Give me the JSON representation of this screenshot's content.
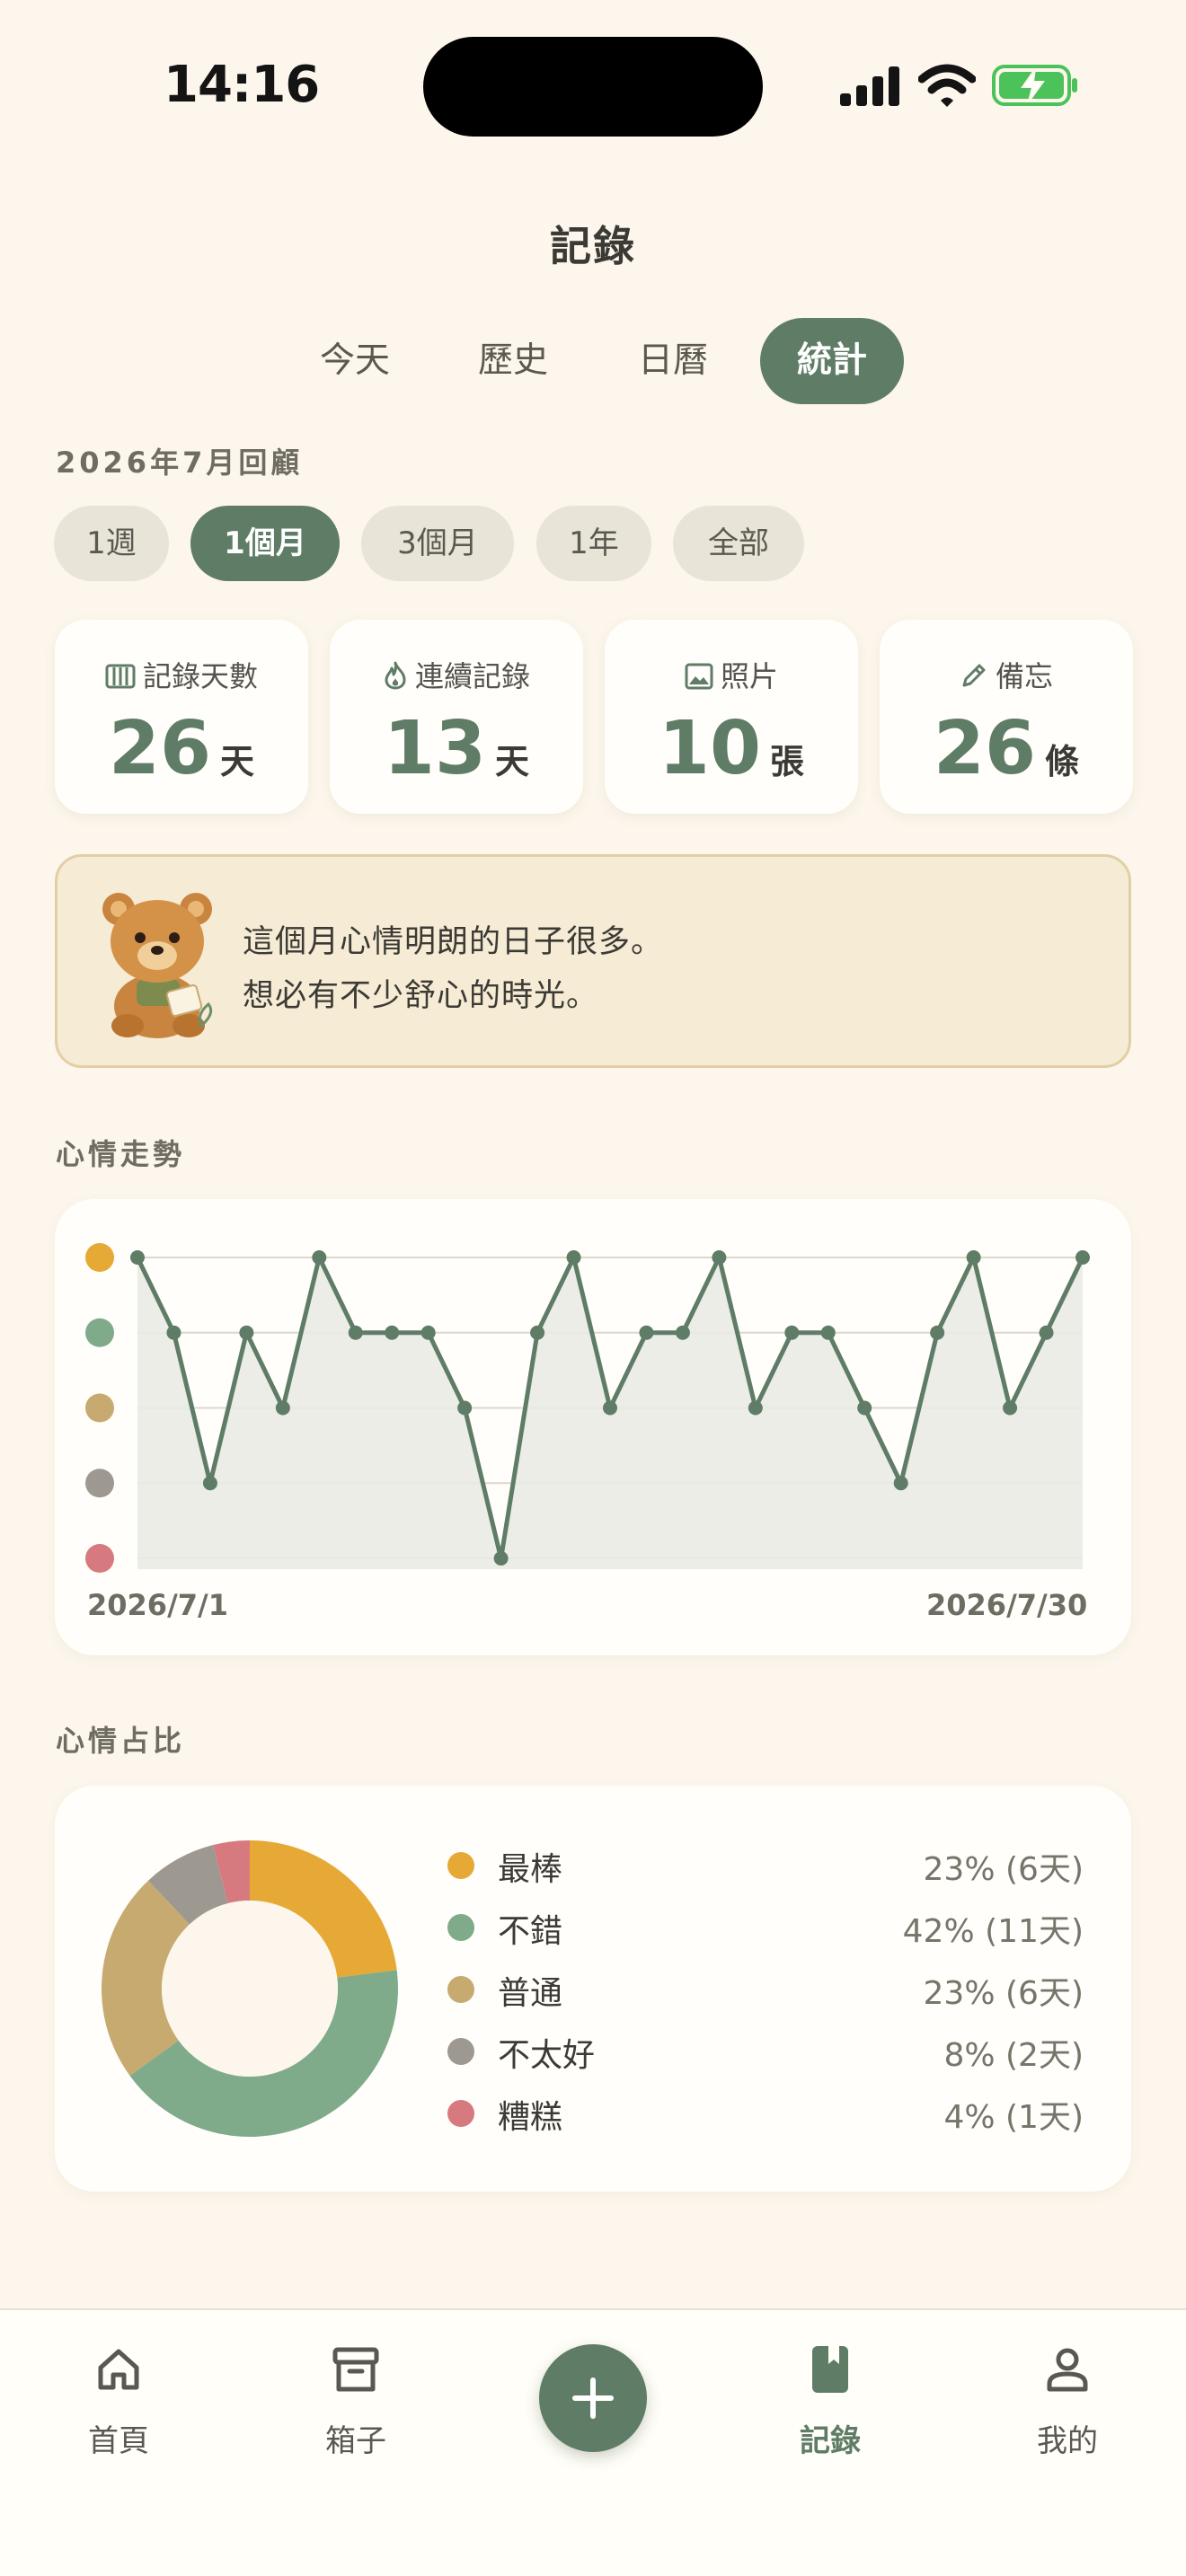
{
  "status": {
    "time": "14:16"
  },
  "title": "記錄",
  "tabs": [
    {
      "label": "今天",
      "active": false
    },
    {
      "label": "歷史",
      "active": false
    },
    {
      "label": "日曆",
      "active": false
    },
    {
      "label": "統計",
      "active": true
    }
  ],
  "review_title": "2026年7月回顧",
  "ranges": [
    {
      "label": "1週",
      "active": false
    },
    {
      "label": "1個月",
      "active": true
    },
    {
      "label": "3個月",
      "active": false
    },
    {
      "label": "1年",
      "active": false
    },
    {
      "label": "全部",
      "active": false
    }
  ],
  "stats": [
    {
      "icon": "barcode-icon",
      "label": "記錄天數",
      "value": "26",
      "unit": "天"
    },
    {
      "icon": "flame-icon",
      "label": "連續記錄",
      "value": "13",
      "unit": "天"
    },
    {
      "icon": "image-icon",
      "label": "照片",
      "value": "10",
      "unit": "張"
    },
    {
      "icon": "pencil-icon",
      "label": "備忘",
      "value": "26",
      "unit": "條"
    }
  ],
  "message": {
    "line1": "這個月心情明朗的日子很多。",
    "line2": "想必有不少舒心的時光。"
  },
  "trend": {
    "title": "心情走勢",
    "start_label": "2026/7/1",
    "end_label": "2026/7/30"
  },
  "ratio": {
    "title": "心情占比",
    "items": [
      {
        "name": "最棒",
        "value": "23% (6天)",
        "color": "#E6A935"
      },
      {
        "name": "不錯",
        "value": "42% (11天)",
        "color": "#80AB8B"
      },
      {
        "name": "普通",
        "value": "23% (6天)",
        "color": "#C7AA6F"
      },
      {
        "name": "不太好",
        "value": "8% (2天)",
        "color": "#9D9990"
      },
      {
        "name": "糟糕",
        "value": "4% (1天)",
        "color": "#D77A7F"
      }
    ]
  },
  "chart_data": [
    {
      "type": "area",
      "title": "心情走勢",
      "y_levels": [
        "糟糕",
        "不太好",
        "普通",
        "不錯",
        "最棒"
      ],
      "level_colors": [
        "#D77A7F",
        "#9D9990",
        "#C7AA6F",
        "#80AB8B",
        "#E6A935"
      ],
      "x_start": "2026/7/1",
      "x_end": "2026/7/30",
      "values": [
        5,
        4,
        2,
        4,
        3,
        5,
        4,
        4,
        4,
        3,
        1,
        4,
        5,
        3,
        4,
        4,
        5,
        3,
        4,
        4,
        3,
        2,
        4,
        5,
        3,
        4,
        5
      ],
      "ylim": [
        1,
        5
      ],
      "grid": true
    },
    {
      "type": "pie",
      "title": "心情占比",
      "labels": [
        "最棒",
        "不錯",
        "普通",
        "不太好",
        "糟糕"
      ],
      "values": [
        23,
        42,
        23,
        8,
        4
      ],
      "days": [
        6,
        11,
        6,
        2,
        1
      ],
      "colors": [
        "#E6A935",
        "#80AB8B",
        "#C7AA6F",
        "#9D9990",
        "#D77A7F"
      ]
    }
  ],
  "nav": [
    {
      "label": "首頁",
      "icon": "home-icon",
      "active": false
    },
    {
      "label": "箱子",
      "icon": "archive-box-icon",
      "active": false
    },
    {
      "label": "記錄",
      "icon": "bookmark-book-icon",
      "active": true
    },
    {
      "label": "我的",
      "icon": "person-icon",
      "active": false
    }
  ],
  "add_icon": "plus-icon"
}
